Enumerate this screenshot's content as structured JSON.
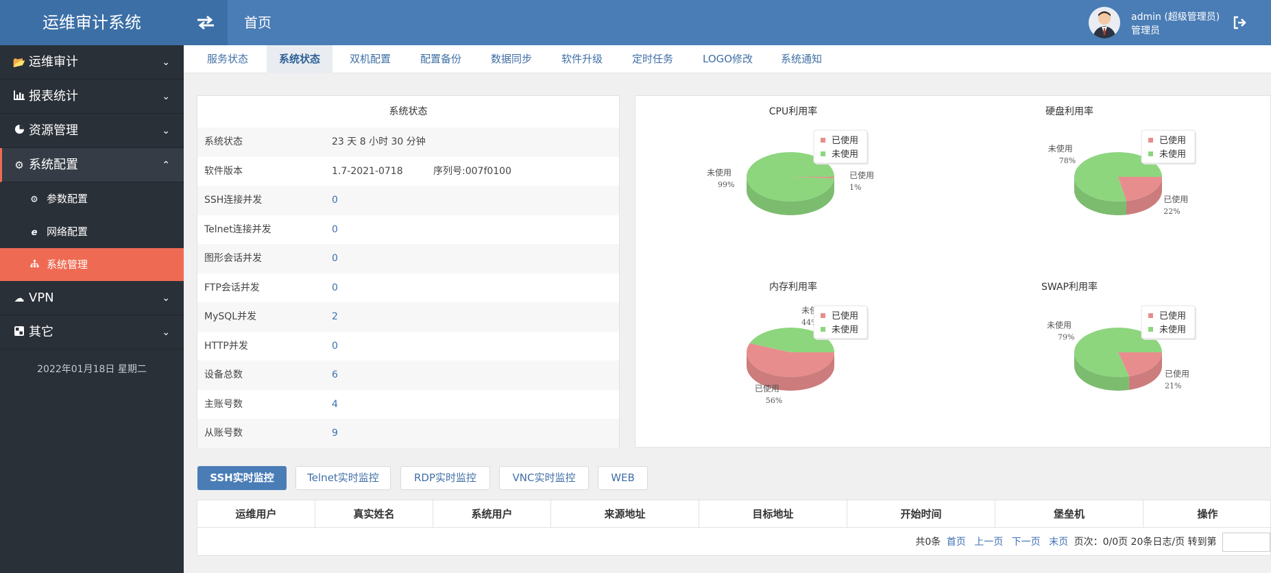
{
  "header": {
    "brand": "运维审计系统",
    "page_title": "首页",
    "user_name": "admin (超级管理员)",
    "user_role": "管理员"
  },
  "sidebar": {
    "items": [
      {
        "label": "运维审计",
        "icon": "folder-open-icon",
        "chevron": "chevron-down"
      },
      {
        "label": "报表统计",
        "icon": "bar-chart-icon",
        "chevron": "chevron-down"
      },
      {
        "label": "资源管理",
        "icon": "pie-chart-icon",
        "chevron": "chevron-down"
      },
      {
        "label": "系统配置",
        "icon": "gear-icon",
        "chevron": "chevron-up"
      },
      {
        "label": "VPN",
        "icon": "cloud-icon",
        "chevron": "chevron-down"
      },
      {
        "label": "其它",
        "icon": "grid-icon",
        "chevron": "chevron-down"
      }
    ],
    "sub_items": [
      {
        "label": "参数配置",
        "icon": "cogs-icon"
      },
      {
        "label": "网络配置",
        "icon": "ie-icon"
      },
      {
        "label": "系统管理",
        "icon": "sitemap-icon"
      }
    ],
    "date": "2022年01月18日 星期二"
  },
  "tabs": [
    "服务状态",
    "系统状态",
    "双机配置",
    "配置备份",
    "数据同步",
    "软件升级",
    "定时任务",
    "LOGO修改",
    "系统通知"
  ],
  "active_tab": "系统状态",
  "status": {
    "title": "系统状态",
    "rows": [
      {
        "key": "系统状态",
        "value": "23 天 8 小时 30 分钟"
      },
      {
        "key": "软件版本",
        "value": "1.7-2021-0718",
        "serial": "序列号:007f0100"
      },
      {
        "key": "SSH连接并发",
        "value": "0"
      },
      {
        "key": "Telnet连接并发",
        "value": "0"
      },
      {
        "key": "图形会话并发",
        "value": "0"
      },
      {
        "key": "FTP会话并发",
        "value": "0"
      },
      {
        "key": "MySQL并发",
        "value": "2"
      },
      {
        "key": "HTTP并发",
        "value": "0"
      },
      {
        "key": "设备总数",
        "value": "6"
      },
      {
        "key": "主账号数",
        "value": "4"
      },
      {
        "key": "从账号数",
        "value": "9"
      }
    ]
  },
  "chart_data": [
    {
      "type": "pie",
      "title": "CPU利用率",
      "legend": [
        "已使用",
        "未使用"
      ],
      "slices": [
        {
          "name": "已使用",
          "value": 1,
          "label": "已使用",
          "pct": "1%"
        },
        {
          "name": "未使用",
          "value": 99,
          "label": "未使用",
          "pct": "99%"
        }
      ],
      "colors": [
        "#e88d8d",
        "#8dd67e"
      ]
    },
    {
      "type": "pie",
      "title": "硬盘利用率",
      "legend": [
        "已使用",
        "未使用"
      ],
      "slices": [
        {
          "name": "已使用",
          "value": 22,
          "label": "已使用",
          "pct": "22%"
        },
        {
          "name": "未使用",
          "value": 78,
          "label": "未使用",
          "pct": "78%"
        }
      ],
      "colors": [
        "#e88d8d",
        "#8dd67e"
      ]
    },
    {
      "type": "pie",
      "title": "内存利用率",
      "legend": [
        "已使用",
        "未使用"
      ],
      "slices": [
        {
          "name": "已使用",
          "value": 56,
          "label": "已使用",
          "pct": "56%"
        },
        {
          "name": "未使用",
          "value": 44,
          "label": "未使",
          "pct": "44%"
        }
      ],
      "colors": [
        "#e88d8d",
        "#8dd67e"
      ]
    },
    {
      "type": "pie",
      "title": "SWAP利用率",
      "legend": [
        "已使用",
        "未使用"
      ],
      "slices": [
        {
          "name": "已使用",
          "value": 21,
          "label": "已使用",
          "pct": "21%"
        },
        {
          "name": "未使用",
          "value": 79,
          "label": "未使用",
          "pct": "79%"
        }
      ],
      "colors": [
        "#e88d8d",
        "#8dd67e"
      ]
    }
  ],
  "monitor_buttons": [
    "SSH实时监控",
    "Telnet实时监控",
    "RDP实时监控",
    "VNC实时监控",
    "WEB"
  ],
  "table": {
    "headers": [
      "运维用户",
      "真实姓名",
      "系统用户",
      "来源地址",
      "目标地址",
      "开始时间",
      "堡垒机",
      "操作"
    ]
  },
  "pager": {
    "total": "共0条",
    "first": "首页",
    "prev": "上一页",
    "next": "下一页",
    "last": "末页",
    "info": "页次：0/0页 20条日志/页 转到第"
  },
  "colors": {
    "primary": "#4a7db6",
    "sidebar": "#2a3038",
    "accent": "#ef6a53",
    "used": "#e88d8d",
    "unused": "#8dd67e"
  }
}
